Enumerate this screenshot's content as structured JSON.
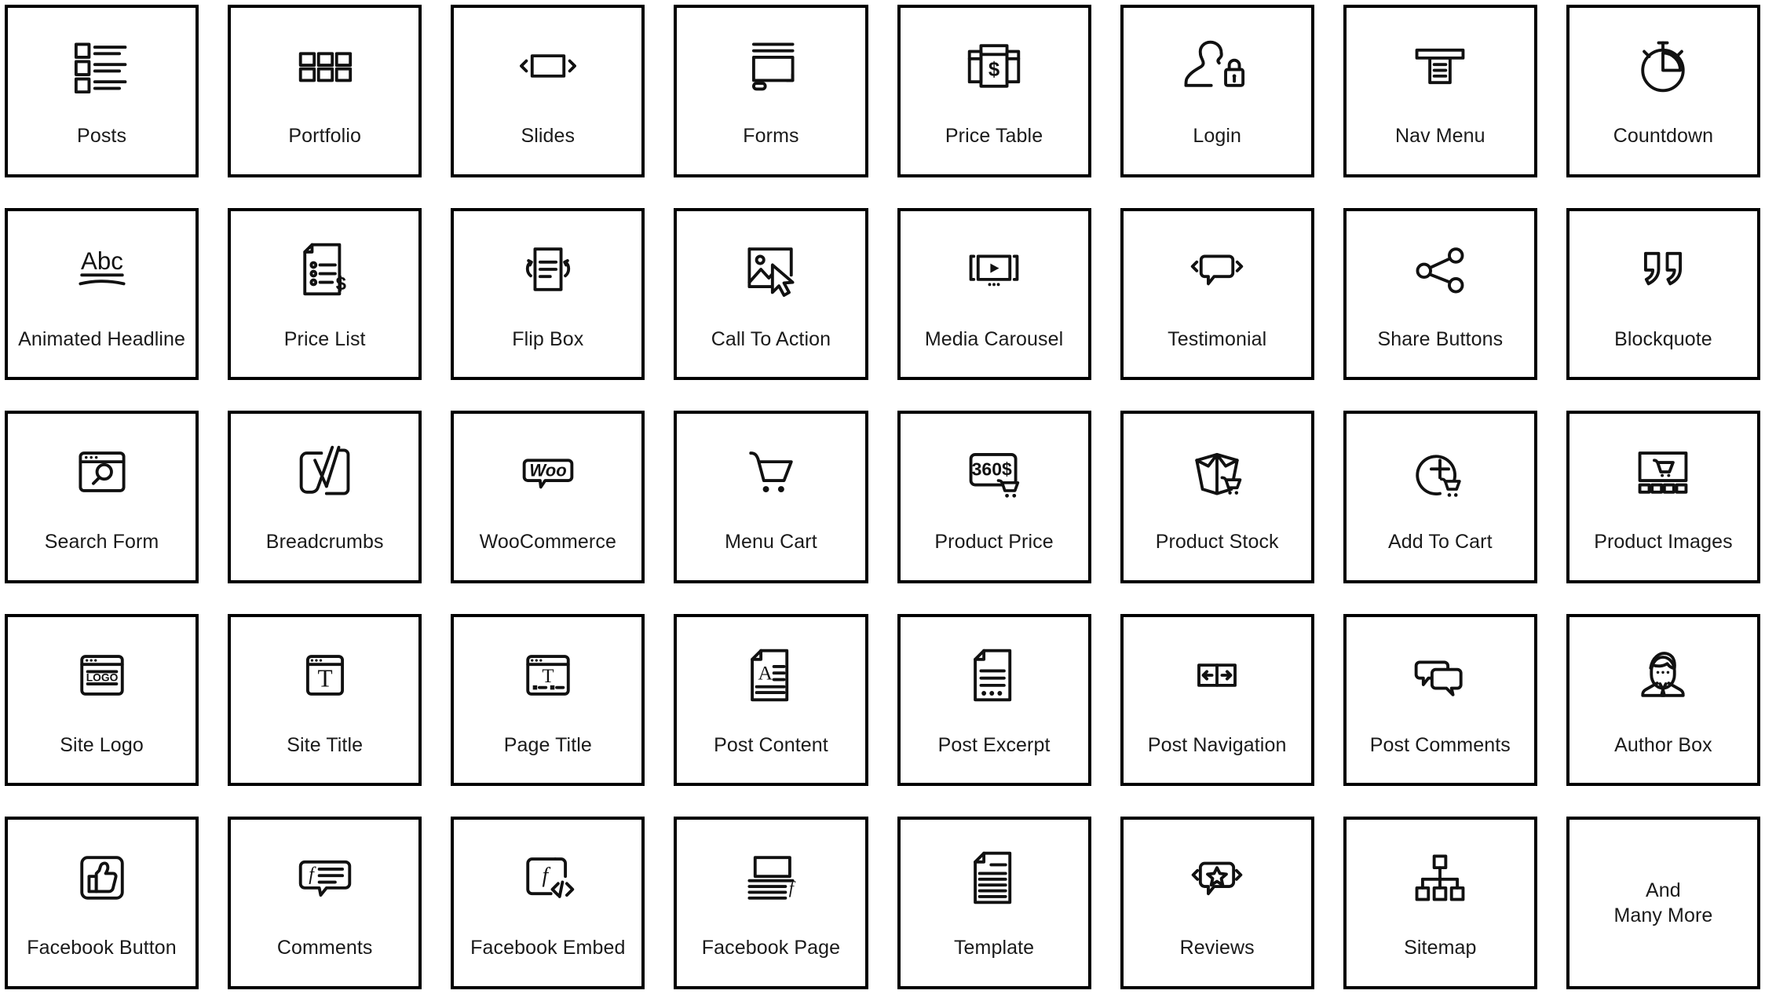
{
  "grid": {
    "columns": 8,
    "rows": 5,
    "stroke_color": "#000000",
    "background_color": "#ffffff",
    "label_color": "#1a1a1a"
  },
  "cards": [
    {
      "label": "Posts",
      "icon": "posts-list-icon"
    },
    {
      "label": "Portfolio",
      "icon": "portfolio-grid-icon"
    },
    {
      "label": "Slides",
      "icon": "slides-arrows-icon"
    },
    {
      "label": "Forms",
      "icon": "forms-monitor-icon"
    },
    {
      "label": "Price Table",
      "icon": "price-table-dollar-icon"
    },
    {
      "label": "Login",
      "icon": "login-user-lock-icon"
    },
    {
      "label": "Nav Menu",
      "icon": "nav-menu-dropdown-icon"
    },
    {
      "label": "Countdown",
      "icon": "countdown-stopwatch-icon"
    },
    {
      "label": "Animated Headline",
      "icon": "animated-headline-abc-icon",
      "icon_text": "Abc"
    },
    {
      "label": "Price List",
      "icon": "price-list-document-dollar-icon"
    },
    {
      "label": "Flip Box",
      "icon": "flip-box-rotate-icon"
    },
    {
      "label": "Call To Action",
      "icon": "call-to-action-image-cursor-icon"
    },
    {
      "label": "Media Carousel",
      "icon": "media-carousel-play-icon"
    },
    {
      "label": "Testimonial",
      "icon": "testimonial-speech-bubble-icon"
    },
    {
      "label": "Share Buttons",
      "icon": "share-nodes-icon"
    },
    {
      "label": "Blockquote",
      "icon": "blockquote-quotation-marks-icon"
    },
    {
      "label": "Search Form",
      "icon": "search-form-browser-magnifier-icon"
    },
    {
      "label": "Breadcrumbs",
      "icon": "breadcrumbs-yoast-icon"
    },
    {
      "label": "WooCommerce",
      "icon": "woocommerce-logo-icon",
      "icon_text": "Woo"
    },
    {
      "label": "Menu Cart",
      "icon": "menu-cart-shopping-cart-icon"
    },
    {
      "label": "Product Price",
      "icon": "product-price-tag-cart-icon",
      "icon_text": "360$"
    },
    {
      "label": "Product Stock",
      "icon": "product-stock-box-cart-icon"
    },
    {
      "label": "Add To Cart",
      "icon": "add-to-cart-plus-circle-icon"
    },
    {
      "label": "Product Images",
      "icon": "product-images-gallery-cart-icon"
    },
    {
      "label": "Site Logo",
      "icon": "site-logo-browser-icon",
      "icon_text": "LOGO"
    },
    {
      "label": "Site Title",
      "icon": "site-title-browser-t-icon",
      "icon_text": "T"
    },
    {
      "label": "Page Title",
      "icon": "page-title-browser-t-meta-icon",
      "icon_text": "T"
    },
    {
      "label": "Post Content",
      "icon": "post-content-document-a-icon",
      "icon_text": "A"
    },
    {
      "label": "Post Excerpt",
      "icon": "post-excerpt-document-ellipsis-icon"
    },
    {
      "label": "Post Navigation",
      "icon": "post-navigation-arrows-icon"
    },
    {
      "label": "Post Comments",
      "icon": "post-comments-bubbles-icon"
    },
    {
      "label": "Author Box",
      "icon": "author-box-person-icon"
    },
    {
      "label": "Facebook Button",
      "icon": "facebook-button-thumbs-up-icon"
    },
    {
      "label": "Comments",
      "icon": "comments-facebook-bubble-icon",
      "icon_text": "f"
    },
    {
      "label": "Facebook Embed",
      "icon": "facebook-embed-code-icon",
      "icon_text": "f"
    },
    {
      "label": "Facebook Page",
      "icon": "facebook-page-layout-icon",
      "icon_text": "f"
    },
    {
      "label": "Template",
      "icon": "template-document-lines-icon"
    },
    {
      "label": "Reviews",
      "icon": "reviews-star-bubble-icon"
    },
    {
      "label": "Sitemap",
      "icon": "sitemap-hierarchy-icon"
    },
    {
      "label": "And\nMany More",
      "icon": "none",
      "text_only": true
    }
  ]
}
